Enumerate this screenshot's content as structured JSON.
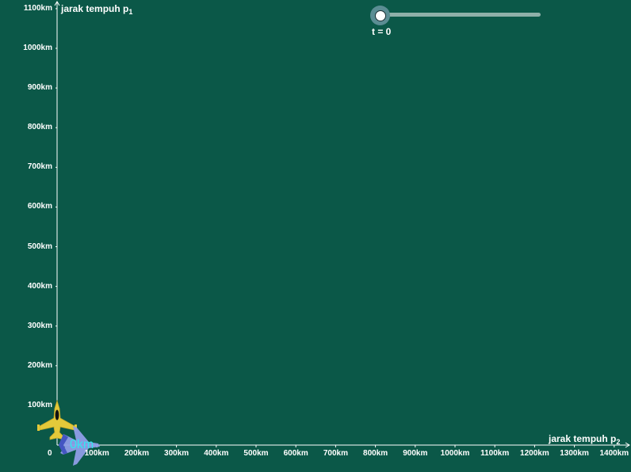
{
  "graph": {
    "y_axis_title": "jarak tempuh p",
    "y_axis_title_sub": "1",
    "x_axis_title": "jarak tempuh p",
    "x_axis_title_sub": "2",
    "origin_label": "0",
    "y_ticks": [
      "100km",
      "200km",
      "300km",
      "400km",
      "500km",
      "600km",
      "700km",
      "800km",
      "900km",
      "1000km",
      "1100km"
    ],
    "x_ticks": [
      "100km",
      "200km",
      "300km",
      "400km",
      "500km",
      "600km",
      "700km",
      "800km",
      "900km",
      "1000km",
      "1100km",
      "1200km",
      "1300km",
      "1400km"
    ],
    "axis_color": "#ffffff",
    "background": "#0b5848"
  },
  "slider": {
    "label": "t = 0",
    "value": 0
  },
  "distance_label": "0km",
  "icons": {
    "fighter_jet": "fighter-jet-icon",
    "airplane": "airplane-icon"
  },
  "colors": {
    "jet": "#e3c93a",
    "airplane": "#8f9ee8",
    "distance_text": "#35e6f0"
  }
}
